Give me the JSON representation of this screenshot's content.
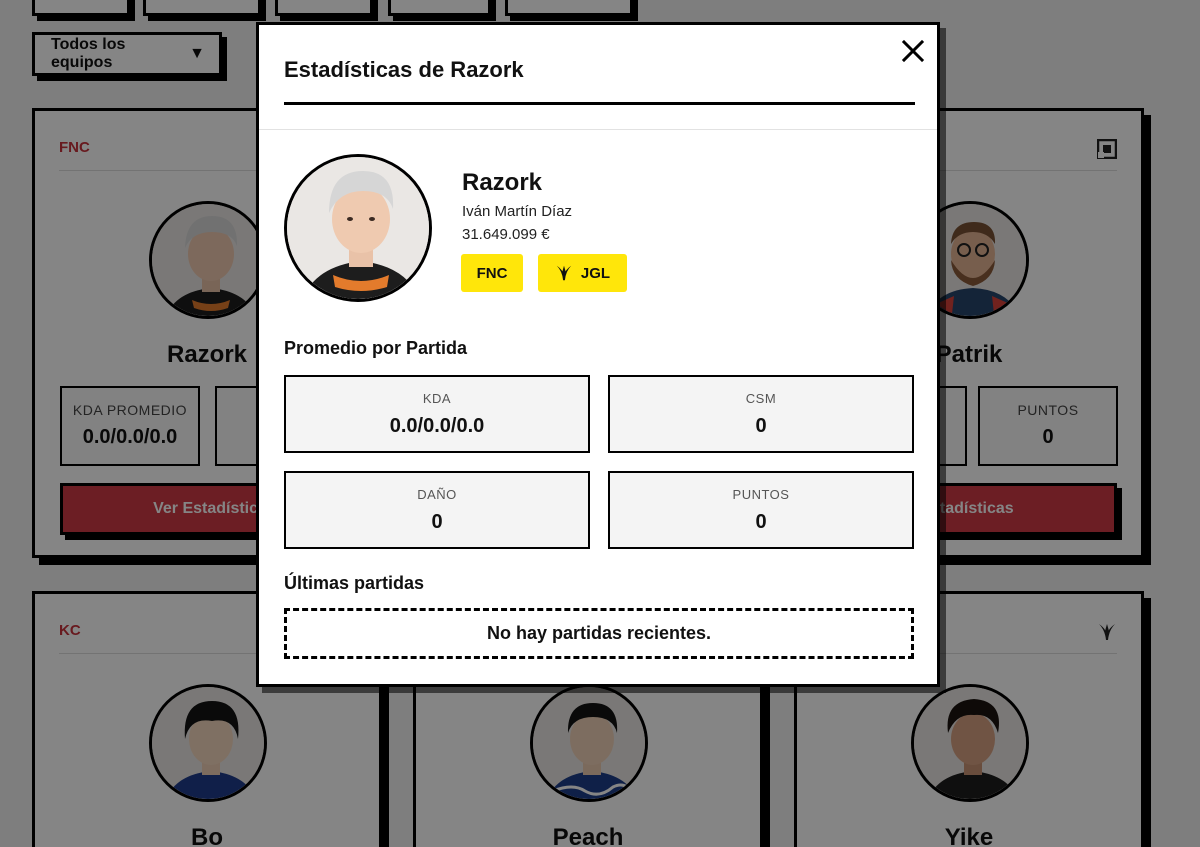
{
  "filter": {
    "team_label": "Todos los equipos"
  },
  "cards": [
    {
      "team": "FNC",
      "name": "Razork",
      "stat_label": "KDA PROMEDIO",
      "stat_value": "0.0/0.0/0.0",
      "button": "Ver Estadística"
    },
    {
      "team": "",
      "name": "Patrik",
      "stat_label": "PUNTOS",
      "stat_value": "0",
      "button": "Estadísticas"
    },
    {
      "team": "KC",
      "name": "Bo"
    },
    {
      "team": "",
      "name": "Peach"
    },
    {
      "team": "",
      "name": "Yike"
    }
  ],
  "modal": {
    "title": "Estadísticas de Razork",
    "close_icon": "close-icon",
    "player": {
      "name": "Razork",
      "real_name": "Iván Martín Díaz",
      "price": "31.649.099 €",
      "team_chip": "FNC",
      "role_chip": "JGL",
      "role_icon": "jungle-icon"
    },
    "average_title": "Promedio por Partida",
    "stats": [
      {
        "label": "KDA",
        "value": "0.0/0.0/0.0"
      },
      {
        "label": "CSM",
        "value": "0"
      },
      {
        "label": "DAÑO",
        "value": "0"
      },
      {
        "label": "PUNTOS",
        "value": "0"
      }
    ],
    "recent_title": "Últimas partidas",
    "recent_empty": "No hay partidas recientes."
  },
  "colors": {
    "accent_yellow": "#ffe60a",
    "accent_red": "#cf3b46",
    "team_red": "#c8323c"
  }
}
